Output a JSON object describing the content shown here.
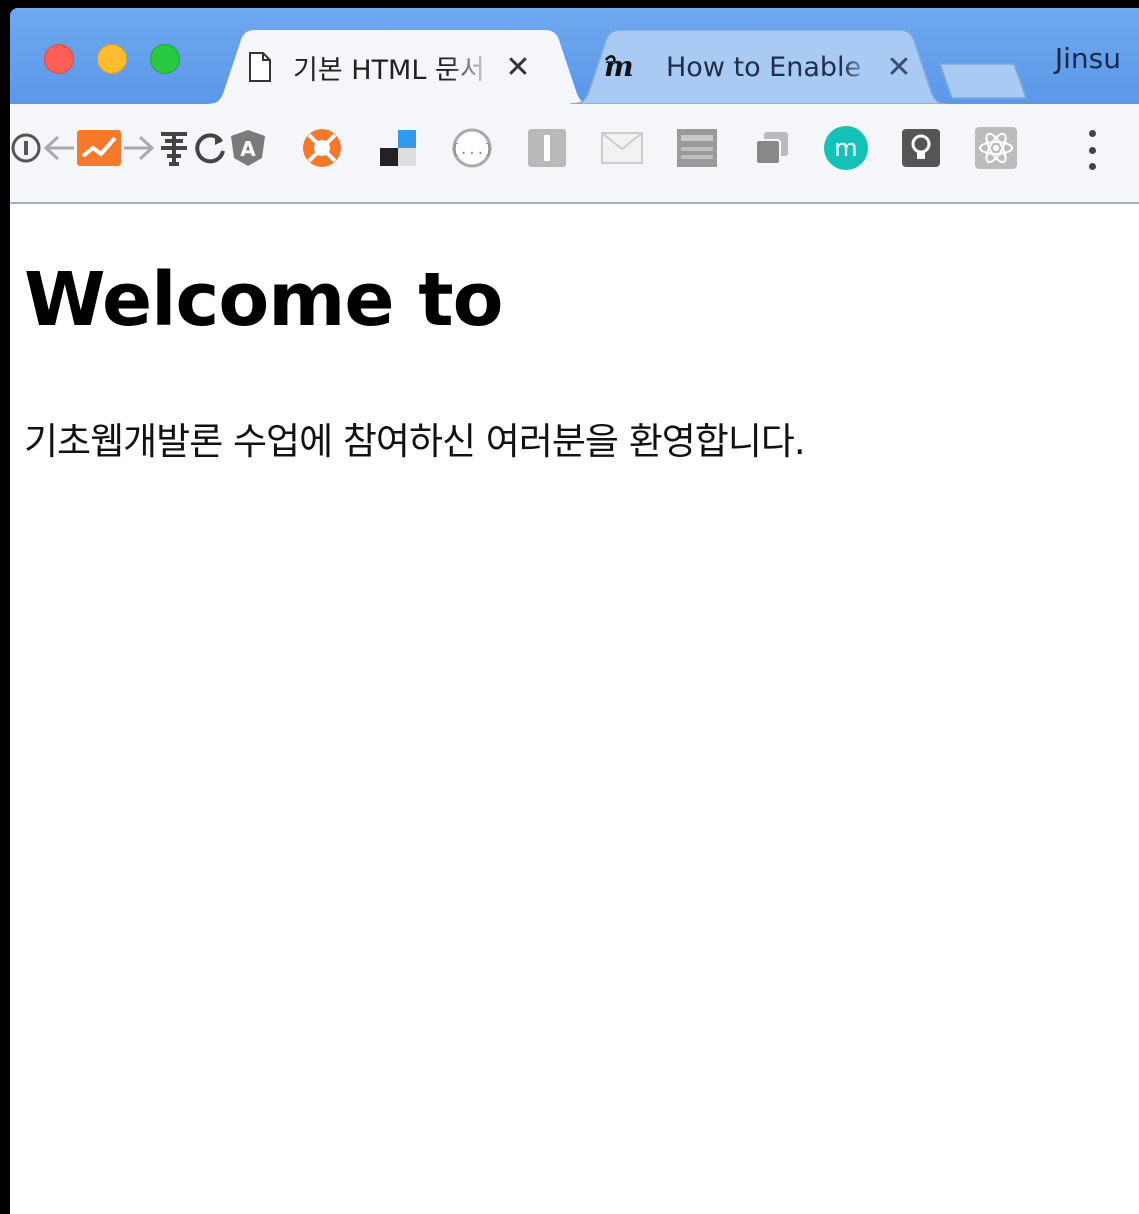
{
  "browser": {
    "tabs": [
      {
        "title": "기본 HTML 문서",
        "close": "✕",
        "icon": "document-icon"
      },
      {
        "title": "How to Enable",
        "close": "✕",
        "icon": "medium-icon"
      }
    ],
    "profile_name": "Jinsu"
  },
  "page": {
    "heading": "Welcome to",
    "paragraph": "기초웹개발론 수업에 참여하신 여러분을 환영합니다."
  },
  "colors": {
    "tabstrip": "#5b98e8",
    "accent_orange": "#f6782a",
    "accent_teal": "#15c2b8"
  }
}
